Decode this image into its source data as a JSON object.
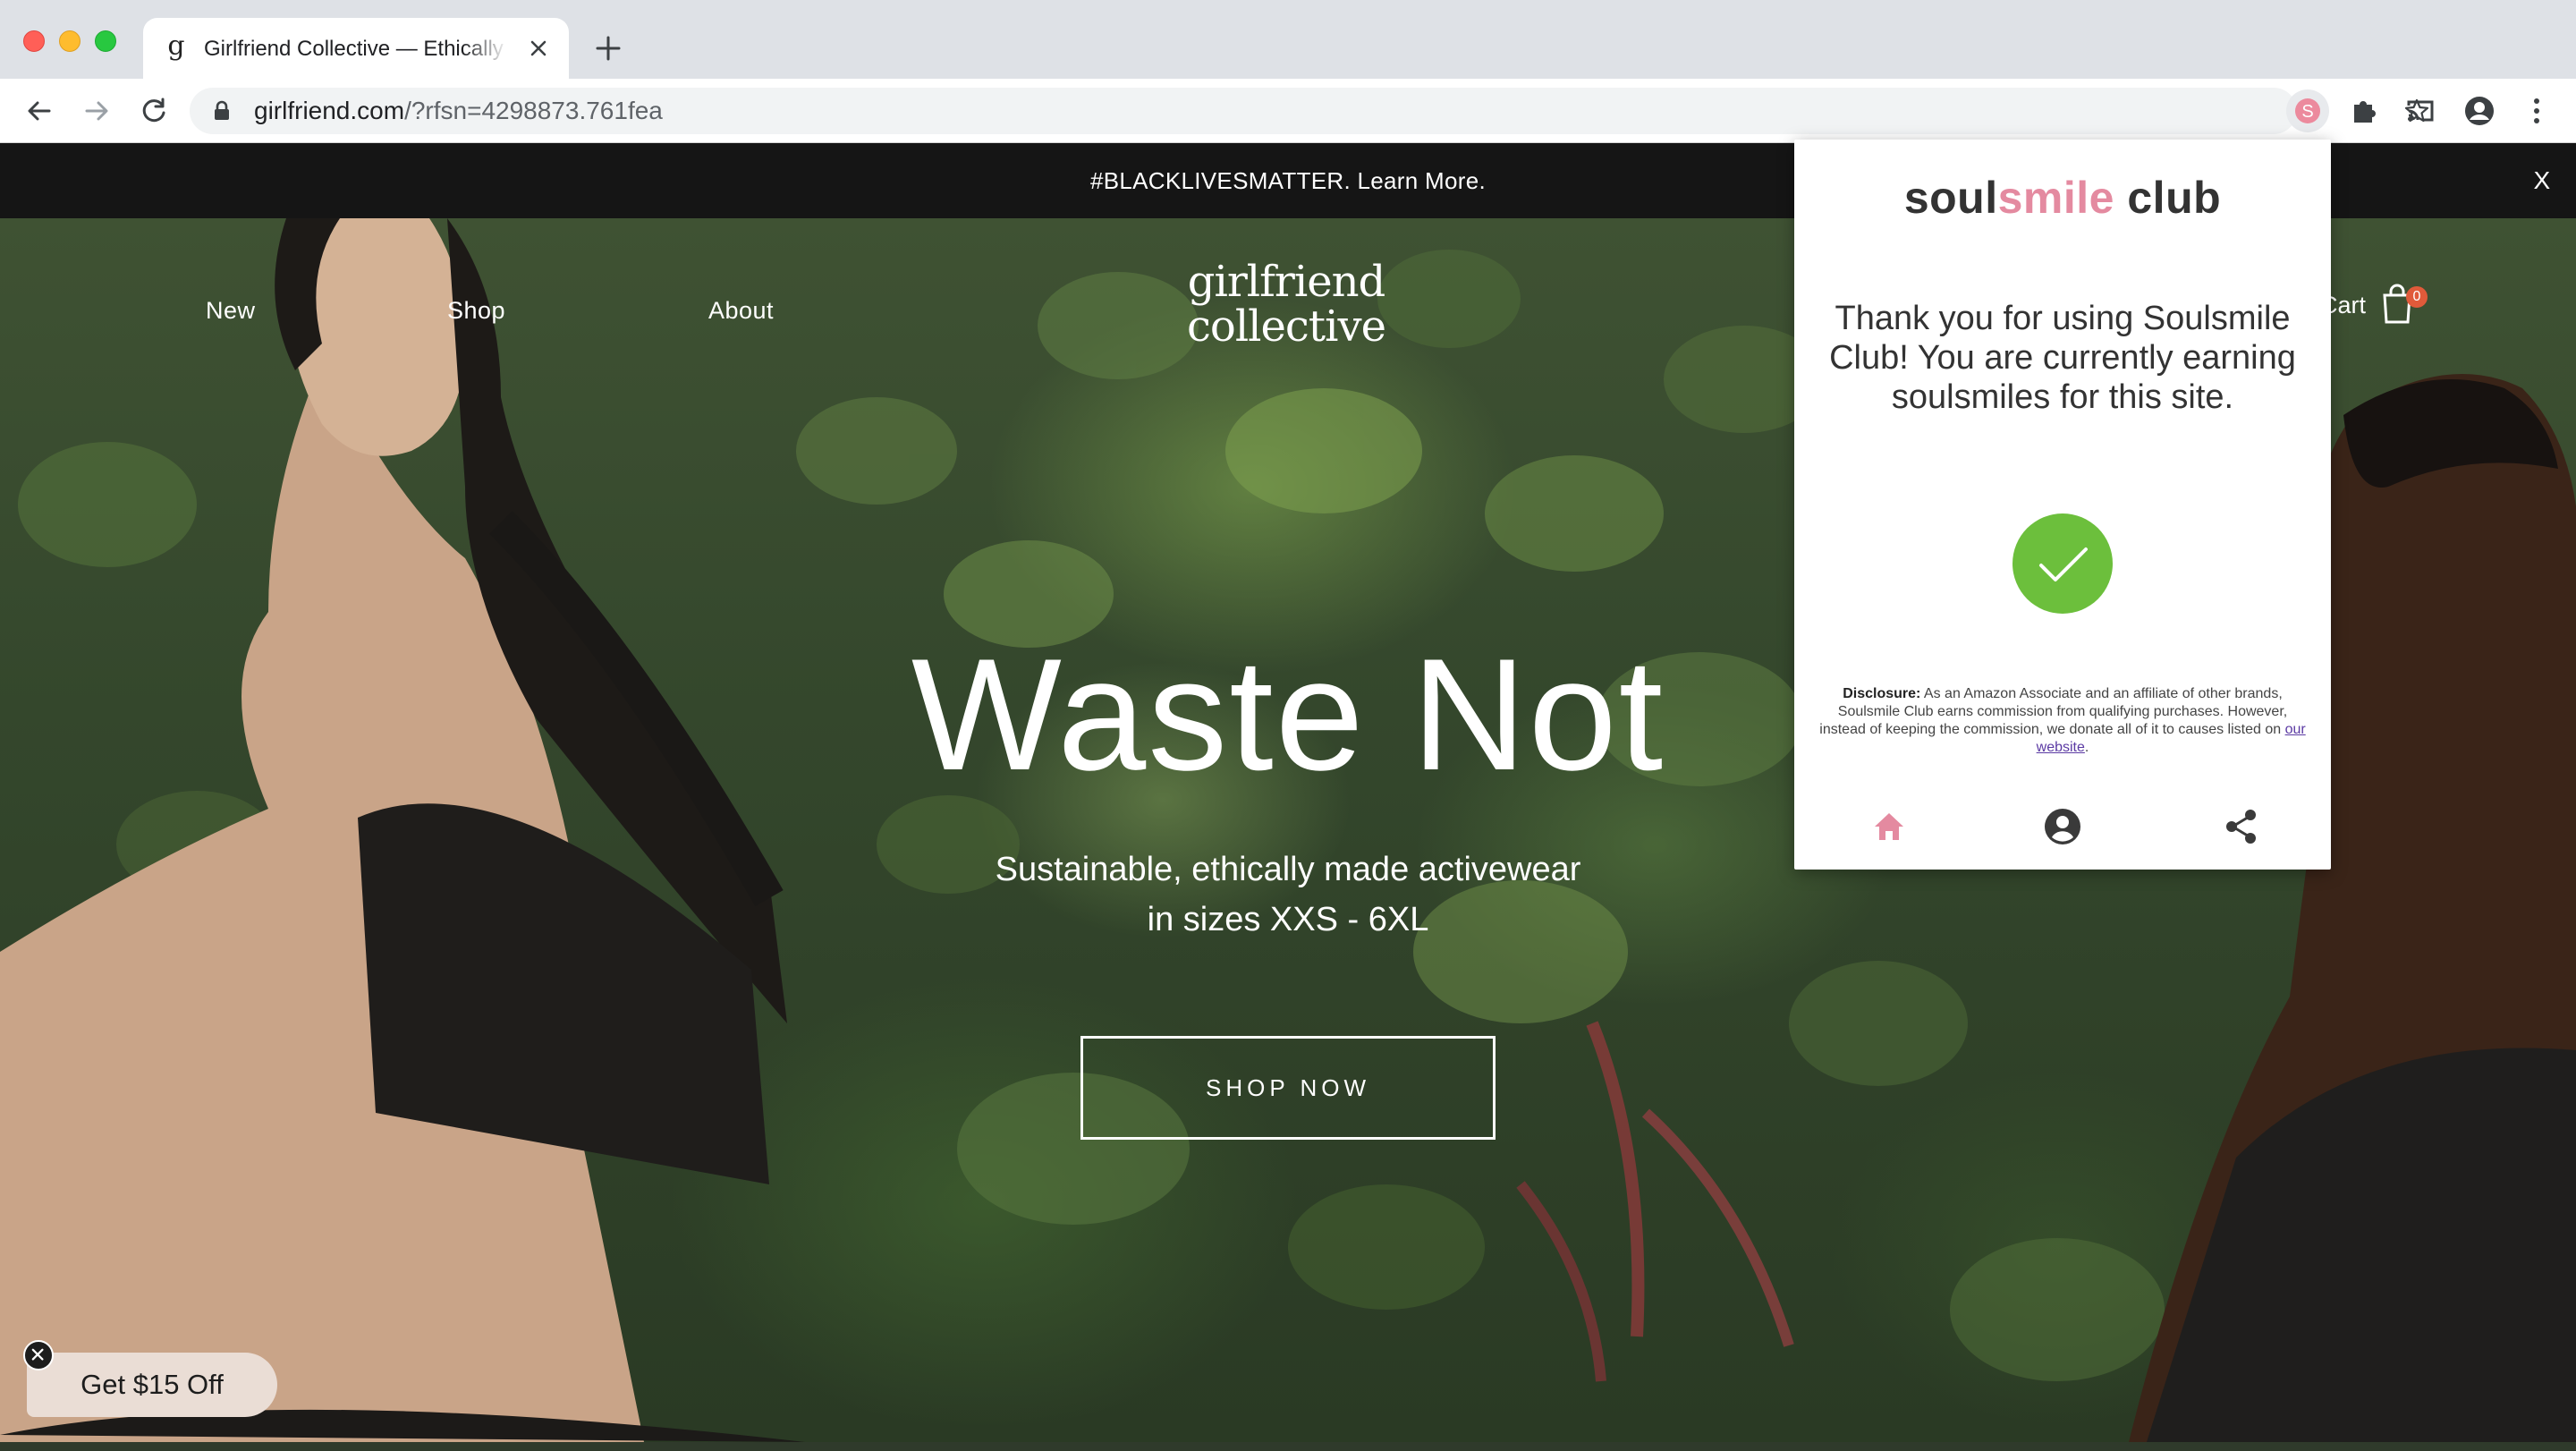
{
  "browser": {
    "tab_title": "Girlfriend Collective — Ethically Made Activewear",
    "tab_favicon": "g",
    "url_host": "girlfriend.com",
    "url_rest": "/?rfsn=4298873.761fea",
    "extension_letter": "S"
  },
  "site": {
    "announcement": "#BLACKLIVESMATTER. Learn More.",
    "announcement_close": "X",
    "nav": {
      "new": "New",
      "shop": "Shop",
      "about": "About",
      "cart": "Cart"
    },
    "logo_line1": "girlfriend",
    "logo_line2": "collective",
    "cart_count": "0",
    "hero_title": "Waste Not",
    "hero_sub_line1": "Sustainable, ethically made activewear",
    "hero_sub_line2": "in sizes XXS - 6XL",
    "shop_button": "SHOP NOW",
    "promo": "Get $15 Off"
  },
  "popup": {
    "brand_part1": "soul",
    "brand_part2": "smile",
    "brand_part3": " club",
    "message": "Thank you for using Soulsmile Club! You are currently earning soulsmiles for this site.",
    "disclosure_label": "Disclosure:",
    "disclosure_text": "As an Amazon Associate and an affiliate of other brands, Soulsmile Club earns commission from qualifying purchases. However, instead of keeping the commission, we donate all of it to causes listed on",
    "disclosure_link": "our website",
    "disclosure_end": ".",
    "accent_pink": "#e48aa0",
    "check_green": "#6cbf3c"
  },
  "icons": [
    "back-icon",
    "forward-icon",
    "reload-icon",
    "lock-icon",
    "star-icon",
    "extension-icon",
    "puzzle-icon",
    "cast-icon",
    "profile-icon",
    "menu-icon",
    "cart-icon",
    "checkmark-icon",
    "home-icon",
    "account-icon",
    "share-icon",
    "close-icon"
  ]
}
